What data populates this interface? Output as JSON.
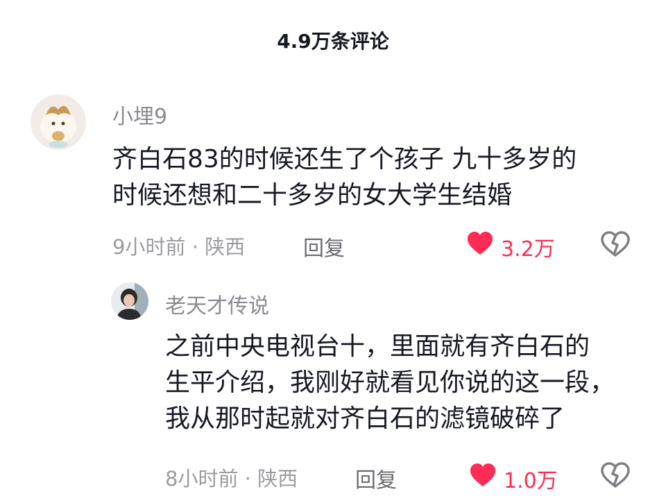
{
  "header": {
    "comment_count": "4.9万条评论"
  },
  "comments": [
    {
      "username": "小埋9",
      "content": "齐白石83的时候还生了个孩子 九十多岁的\n时候还想和二十多岁的女大学生结婚",
      "meta": "9小时前 · 陕西",
      "reply_label": "回复",
      "likes": "3.2万"
    },
    {
      "username": "老天才传说",
      "content": "之前中央电视台十，里面就有齐白石的\n生平介绍，我刚好就看见你说的这一段，\n我从那时起就对齐白石的滤镜破碎了",
      "meta": "8小时前 · 陕西",
      "reply_label": "回复",
      "likes": "1.0万"
    }
  ],
  "colors": {
    "like": "#fe2c55",
    "text": "#161823",
    "secondary": "#8a8b91"
  },
  "icons": {
    "like": "heart-icon",
    "dislike": "broken-heart-icon"
  }
}
